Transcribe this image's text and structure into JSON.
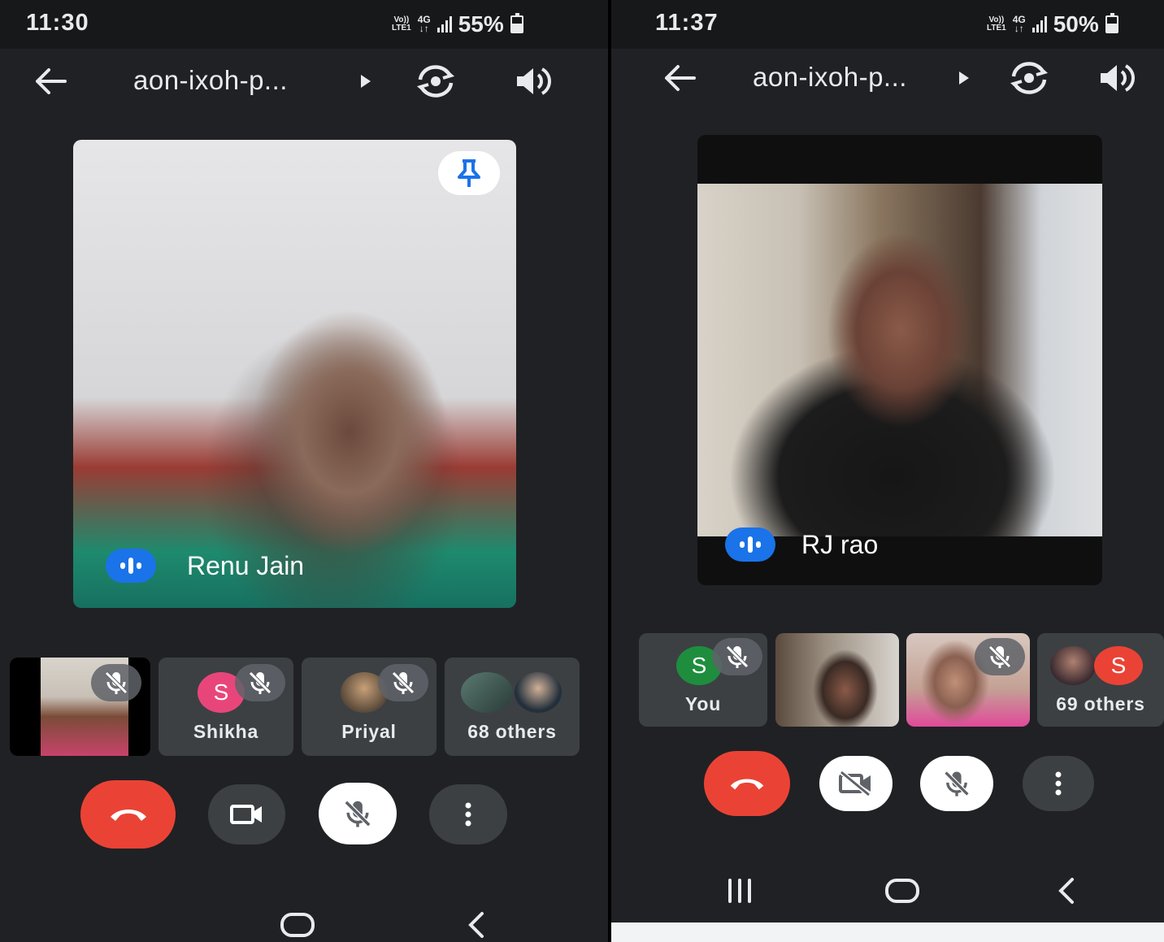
{
  "left": {
    "status": {
      "time": "11:30",
      "volte_top": "Vo))",
      "volte_bottom": "LTE1",
      "net_top": "4G",
      "net_bottom": "↓↑",
      "battery": "55%"
    },
    "meeting_code": "aon-ixoh-p...",
    "main_tile": {
      "name": "Renu Jain",
      "pinned": true
    },
    "thumbnails": [
      {
        "type": "video",
        "muted": true
      },
      {
        "type": "avatar",
        "initial": "S",
        "avatar_color": "#e8467a",
        "name": "Shikha",
        "muted": true
      },
      {
        "type": "photo",
        "name": "Priyal",
        "muted": true
      },
      {
        "type": "group",
        "name": "68 others"
      }
    ],
    "controls": {
      "camera": "on",
      "mic": "muted"
    }
  },
  "right": {
    "status": {
      "time": "11:37",
      "volte_top": "Vo))",
      "volte_bottom": "LTE1",
      "net_top": "4G",
      "net_bottom": "↓↑",
      "battery": "50%"
    },
    "meeting_code": "aon-ixoh-p...",
    "main_tile": {
      "name": "RJ rao"
    },
    "thumbnails": [
      {
        "type": "avatar",
        "initial": "S",
        "avatar_color": "#1e8e3e",
        "name": "You",
        "muted": true
      },
      {
        "type": "video",
        "muted": false
      },
      {
        "type": "video",
        "muted": true
      },
      {
        "type": "group",
        "initial": "S",
        "avatar_color": "#ea4335",
        "name": "69 others"
      }
    ],
    "controls": {
      "camera": "off",
      "mic": "muted"
    }
  },
  "colors": {
    "background": "#202124",
    "tile": "#3c4043",
    "hangup": "#ea4335",
    "accent": "#1a73e8"
  }
}
